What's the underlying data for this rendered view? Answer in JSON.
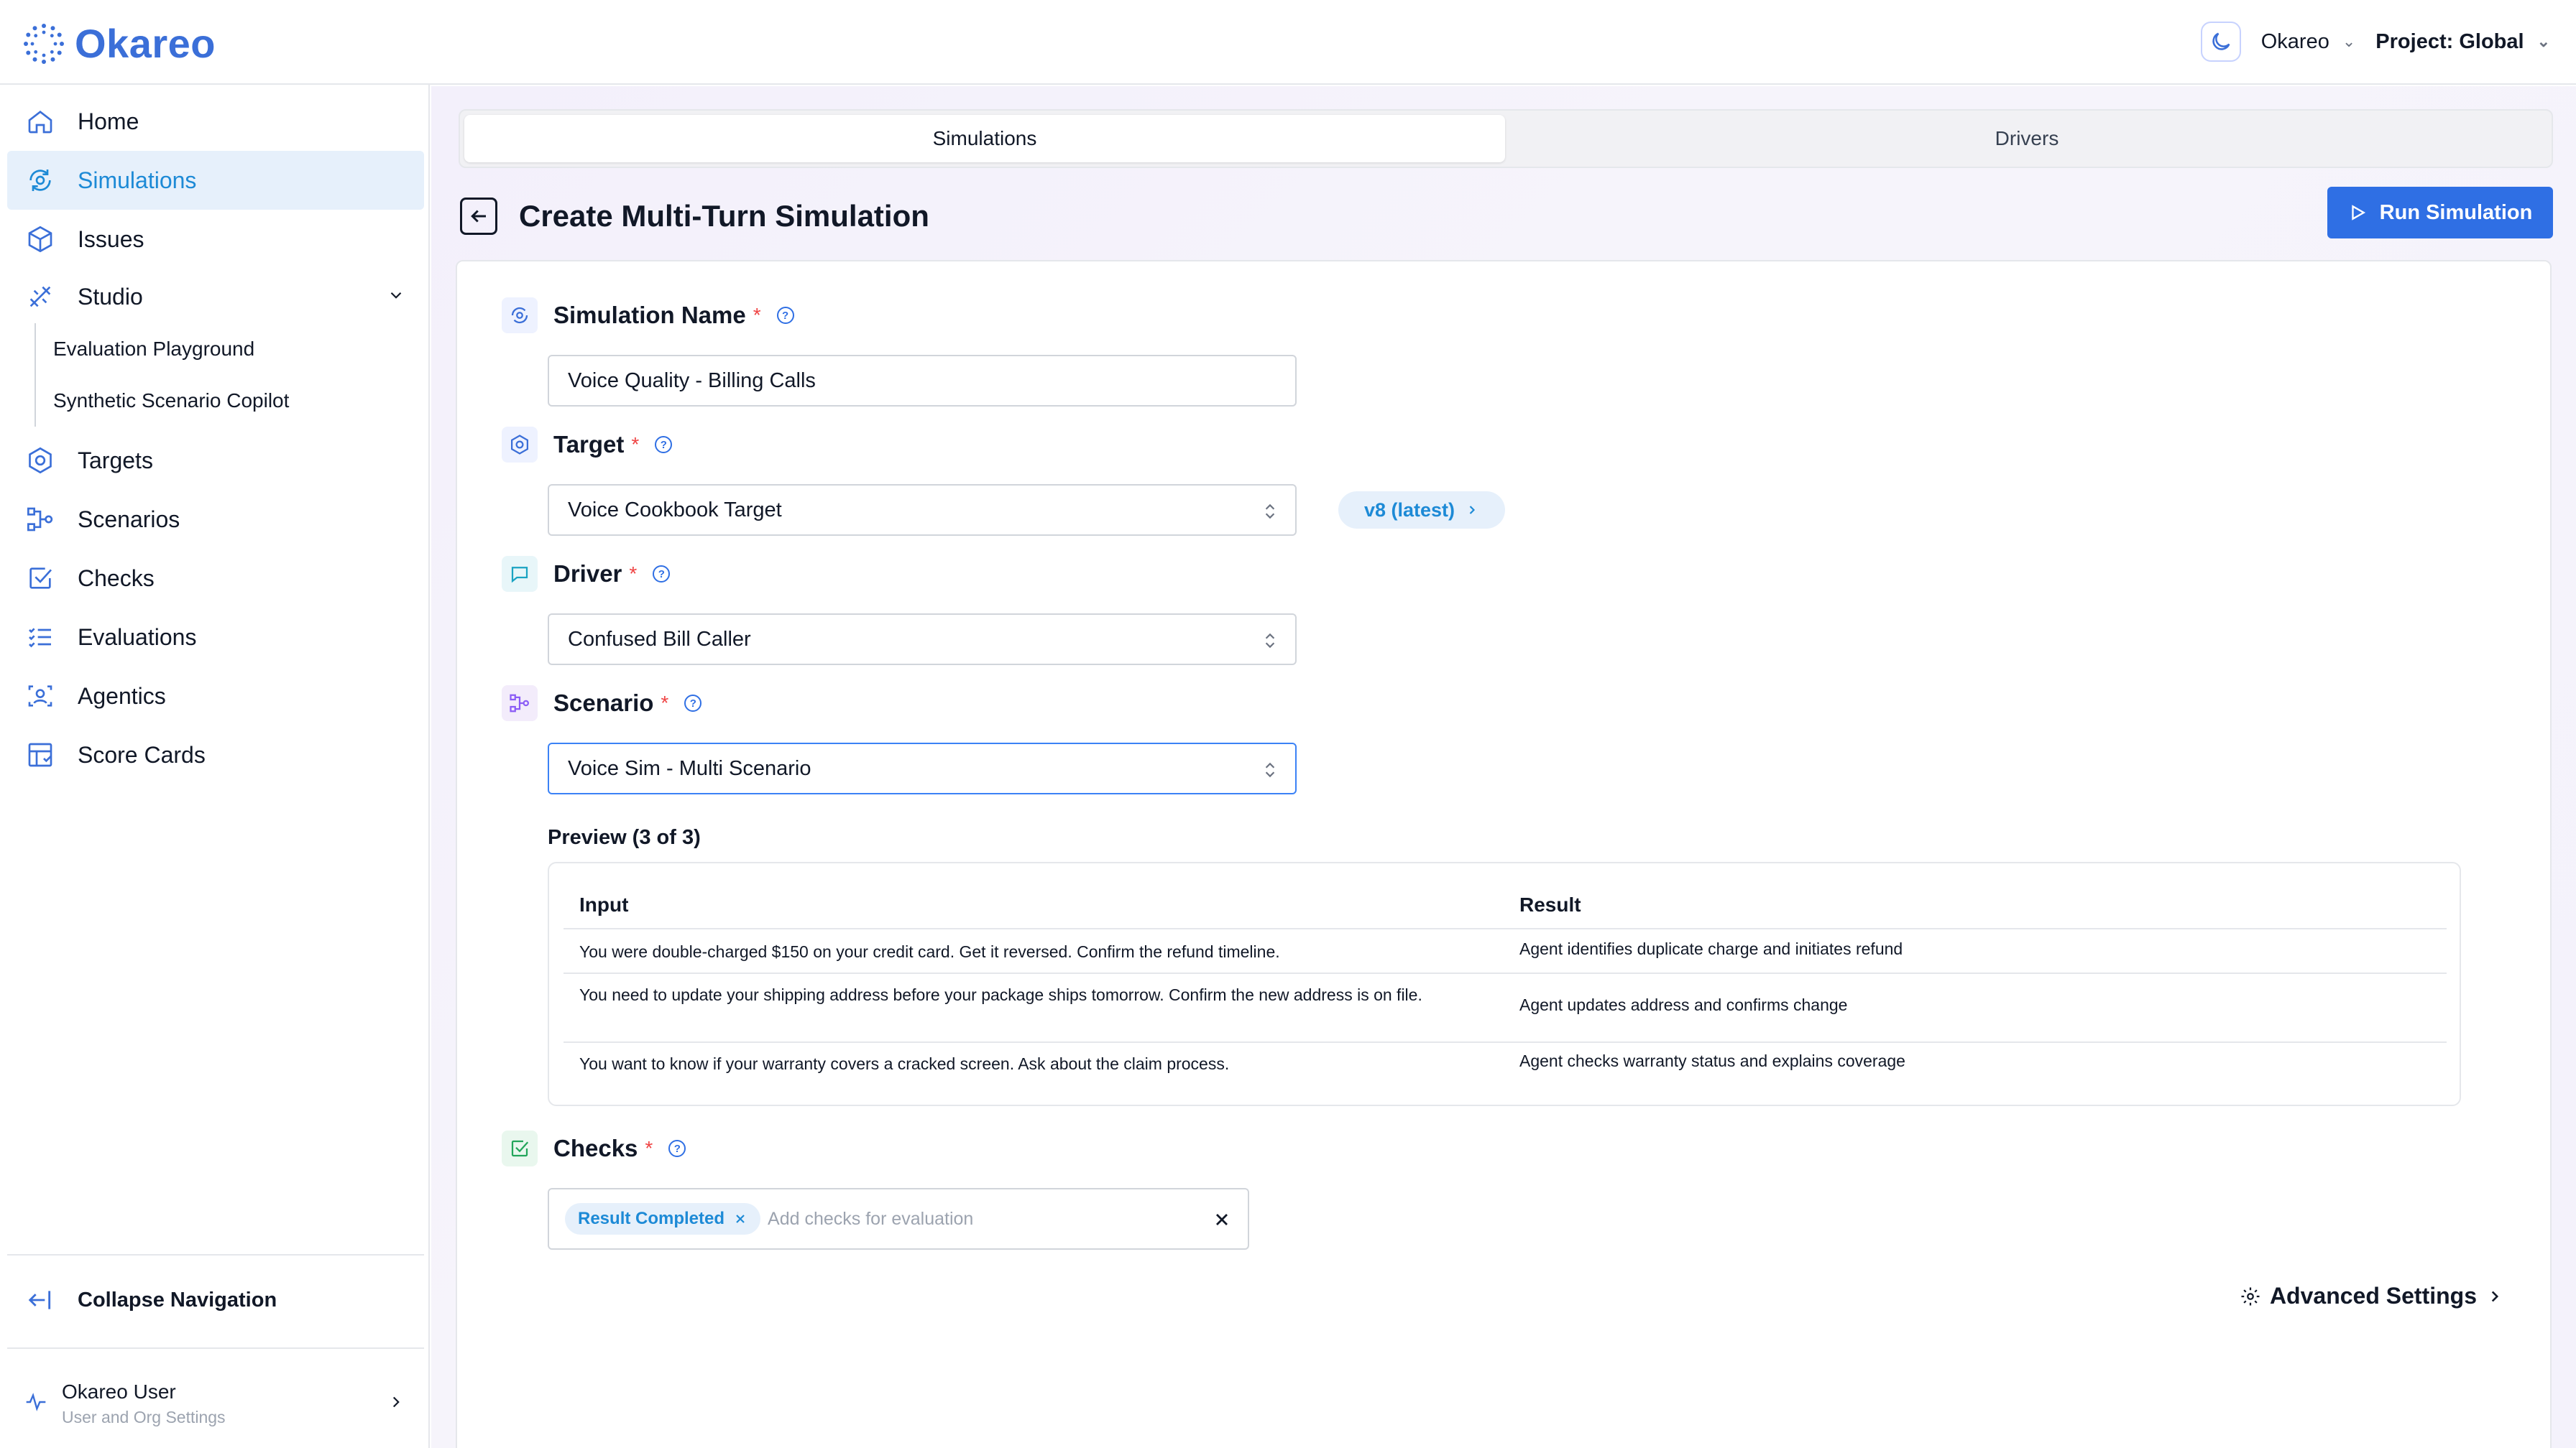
{
  "app": {
    "logo_text": "Okareo",
    "brand_color": "#3b6fd8",
    "accent_color": "#2f6fe4"
  },
  "header": {
    "org_label": "Okareo",
    "project_label": "Project: Global",
    "theme_icon": "moon-icon"
  },
  "sidebar": {
    "items": [
      {
        "label": "Home",
        "icon": "home-icon"
      },
      {
        "label": "Simulations",
        "icon": "simulation-icon",
        "active": true
      },
      {
        "label": "Issues",
        "icon": "cube-icon"
      },
      {
        "label": "Studio",
        "icon": "tools-icon"
      },
      {
        "label": "Targets",
        "icon": "hexagon-icon"
      },
      {
        "label": "Scenarios",
        "icon": "flow-icon"
      },
      {
        "label": "Checks",
        "icon": "checkbox-icon"
      },
      {
        "label": "Evaluations",
        "icon": "list-check-icon"
      },
      {
        "label": "Agentics",
        "icon": "agent-scan-icon"
      },
      {
        "label": "Score Cards",
        "icon": "table-icon"
      }
    ],
    "studio_sub_items": [
      "Evaluation Playground",
      "Synthetic Scenario Copilot"
    ],
    "collapse_label": "Collapse Navigation",
    "user_name": "Okareo User",
    "user_sub": "User and Org Settings"
  },
  "tabs": [
    {
      "label": "Simulations",
      "active": true
    },
    {
      "label": "Drivers",
      "active": false
    }
  ],
  "page": {
    "title": "Create Multi-Turn Simulation",
    "run_button": "Run Simulation"
  },
  "form": {
    "simulation_name": {
      "label": "Simulation Name",
      "value": "Voice Quality - Billing Calls"
    },
    "target": {
      "label": "Target",
      "value": "Voice Cookbook Target",
      "version": "v8 (latest)"
    },
    "driver": {
      "label": "Driver",
      "value": "Confused Bill Caller"
    },
    "scenario": {
      "label": "Scenario",
      "value": "Voice Sim - Multi Scenario"
    },
    "required_mark": "*",
    "help_mark": "?"
  },
  "preview": {
    "label": "Preview (3 of 3)",
    "columns": [
      "Input",
      "Result"
    ],
    "rows": [
      {
        "input": "You were double-charged $150 on your credit card. Get it reversed. Confirm the refund timeline.",
        "result": "Agent identifies duplicate charge and initiates refund"
      },
      {
        "input": "You need to update your shipping address before your package ships tomorrow. Confirm the new address is on file.",
        "result": "Agent updates address and confirms change"
      },
      {
        "input": "You want to know if your warranty covers a cracked screen. Ask about the claim process.",
        "result": "Agent checks warranty status and explains coverage"
      }
    ]
  },
  "checks": {
    "label": "Checks",
    "chips": [
      "Result Completed"
    ],
    "placeholder": "Add checks for evaluation"
  },
  "advanced_settings": "Advanced Settings"
}
